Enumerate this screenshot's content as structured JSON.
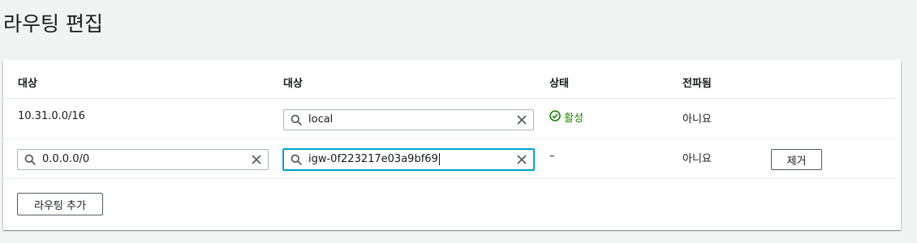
{
  "page": {
    "title": "라우팅 편집"
  },
  "table": {
    "headers": [
      "대상",
      "대상",
      "상태",
      "전파됨"
    ],
    "rows": [
      {
        "destination": "10.31.0.0/16",
        "target": "local",
        "status": "활성",
        "propagated": "아니요"
      },
      {
        "destination": "0.0.0.0/0",
        "target": "igw-0f223217e03a9bf69",
        "status": "–",
        "propagated": "아니요",
        "remove_label": "제거"
      }
    ]
  },
  "add_route_label": "라우팅 추가",
  "colors": {
    "focus_border": "#00a1c9",
    "status_active": "#1d8102",
    "background": "#f2f3f3"
  },
  "icons": {
    "search": "search-icon",
    "clear": "close-icon",
    "status_active": "check-circle-icon"
  }
}
